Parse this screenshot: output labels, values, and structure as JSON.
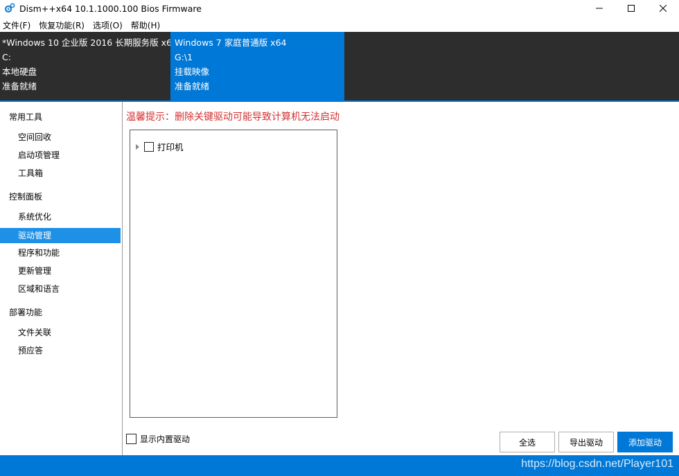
{
  "window": {
    "title": "Dism++x64 10.1.1000.100 Bios Firmware",
    "icon": "gear-icon"
  },
  "menu": [
    "文件(F)",
    "恢复功能(R)",
    "选项(O)",
    "帮助(H)"
  ],
  "images": [
    {
      "name": "*Windows 10 企业版 2016 长期服务版 x64",
      "path": "C:",
      "type": "本地硬盘",
      "status": "准备就绪"
    },
    {
      "name": "Windows 7 家庭普通版 x64",
      "path": "G:\\1",
      "type": "挂载映像",
      "status": "准备就绪"
    }
  ],
  "sidebar": {
    "groups": [
      {
        "label": "常用工具",
        "items": [
          "空间回收",
          "启动项管理",
          "工具箱"
        ]
      },
      {
        "label": "控制面板",
        "items": [
          "系统优化",
          "驱动管理",
          "程序和功能",
          "更新管理",
          "区域和语言"
        ]
      },
      {
        "label": "部署功能",
        "items": [
          "文件关联",
          "预应答"
        ]
      }
    ],
    "active": "驱动管理"
  },
  "main": {
    "warning": "温馨提示：删除关键驱动可能导致计算机无法启动",
    "tree": [
      {
        "label": "打印机",
        "checked": false,
        "expanded": false
      }
    ],
    "show_builtin_label": "显示内置驱动",
    "show_builtin_checked": false,
    "buttons": {
      "select_all": "全选",
      "export": "导出驱动",
      "add": "添加驱动"
    }
  },
  "watermark": "https://blog.csdn.net/Player101",
  "colors": {
    "accent": "#0078d7",
    "warning": "#d32f2f",
    "dark_panel": "#2d2d2d"
  }
}
